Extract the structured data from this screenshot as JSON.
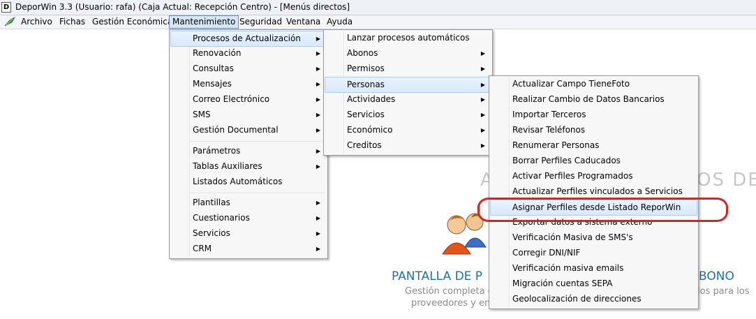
{
  "window": {
    "title": "DeporWin 3.3  (Usuario: rafa)  (Caja Actual: Recepción Centro) - [Menús directos]",
    "app_icon_letter": "D"
  },
  "menubar": {
    "items": [
      "Archivo",
      "Fichas",
      "Gestión Económica",
      "Mantenimiento",
      "Seguridad",
      "Ventana",
      "Ayuda"
    ],
    "active": "Mantenimiento"
  },
  "menu_mantenimiento": [
    "Procesos de Actualización",
    "Renovación",
    "Consultas",
    "Mensajes",
    "Correo Electrónico",
    "SMS",
    "Gestión Documental",
    "Parámetros",
    "Tablas Auxiliares",
    "Listados Automáticos",
    "Plantillas",
    "Cuestionarios",
    "Servicios",
    "CRM"
  ],
  "menu_procesos": [
    "Lanzar procesos automáticos",
    "Abonos",
    "Permisos",
    "Personas",
    "Actividades",
    "Servicios",
    "Económico",
    "Creditos"
  ],
  "menu_personas": [
    "Actualizar Campo TieneFoto",
    "Realizar Cambio de Datos Bancarios",
    "Importar Terceros",
    "Revisar Teléfonos",
    "Renumerar Personas",
    "Borrar Perfiles Caducados",
    "Activar Perfiles Programados",
    "Actualizar Perfiles vinculados a Servicios",
    "Asignar Perfiles desde Listado ReporWin",
    "Exportar datos a sistema externo",
    "Verificación Masiva de SMS's",
    "Corregir DNI/NIF",
    "Verificación masiva emails",
    "Migración cuentas SEPA",
    "Geolocalización de direcciones"
  ],
  "background": {
    "heading_left_fragment": "A",
    "heading_right_fragment": "OS DE",
    "pantalla_left": "PANTALLA DE P",
    "pantalla_right": "BONO",
    "sub_line1_left": "Gestión completa de",
    "sub_line1_right": "ios para los",
    "sub_line2_left": "proveedores y em"
  },
  "colors": {
    "highlight": "#d9e8fb",
    "callout": "#e02020",
    "accent_text": "#1f6fa8"
  }
}
